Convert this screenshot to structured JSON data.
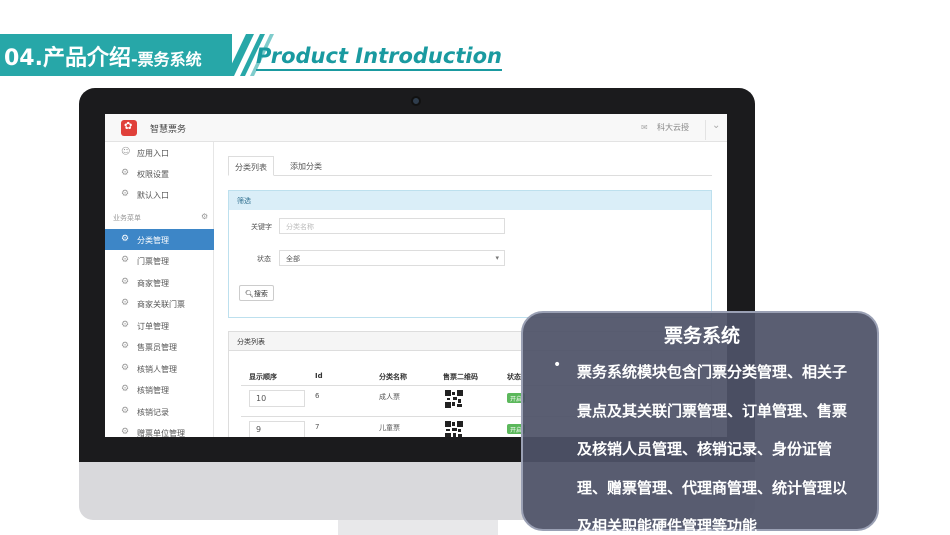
{
  "header": {
    "title_main": "04.产品介绍",
    "title_sub": "-票务系统",
    "title_en": "Product Introduction"
  },
  "app": {
    "name": "智慧票务",
    "user": "科大云授",
    "sidebar": {
      "items_top": [
        {
          "label": "应用入口",
          "icon": "chat-icon"
        },
        {
          "label": "权限设置",
          "icon": "gear-icon"
        },
        {
          "label": "默认入口",
          "icon": "gear-icon"
        }
      ],
      "section_title": "业务菜单",
      "items": [
        {
          "label": "分类管理",
          "active": true
        },
        {
          "label": "门票管理"
        },
        {
          "label": "商家管理"
        },
        {
          "label": "商家关联门票"
        },
        {
          "label": "订单管理"
        },
        {
          "label": "售票员管理"
        },
        {
          "label": "核销人管理"
        },
        {
          "label": "核销管理"
        },
        {
          "label": "核销记录"
        },
        {
          "label": "赠票单位管理"
        }
      ]
    },
    "tabs": [
      {
        "label": "分类列表",
        "active": true
      },
      {
        "label": "添加分类"
      }
    ],
    "filter": {
      "heading": "筛选",
      "keyword_label": "关键字",
      "keyword_placeholder": "分类名称",
      "status_label": "状态",
      "status_value": "全部",
      "search_label": "搜索"
    },
    "list": {
      "heading": "分类列表",
      "columns": [
        "显示顺序",
        "Id",
        "分类名称",
        "售票二维码",
        "状态"
      ],
      "rows": [
        {
          "order": "10",
          "id": "6",
          "name": "成人票",
          "status": "开启"
        },
        {
          "order": "9",
          "id": "7",
          "name": "儿童票",
          "status": "开启"
        }
      ]
    }
  },
  "card": {
    "title": "票务系统",
    "bullet": "•",
    "text": "票务系统模块包含门票分类管理、相关子景点及其关联门票管理、订单管理、售票及核销人员管理、核销记录、身份证管理、赠票管理、代理商管理、统计管理以及相关职能硬件管理等功能"
  },
  "colors": {
    "banner": "#27a7a8",
    "accent_en": "#1a9aa0",
    "sidebar_active": "#3d86c7",
    "card_bg": "#4d5267",
    "badge": "#5cb85c"
  }
}
